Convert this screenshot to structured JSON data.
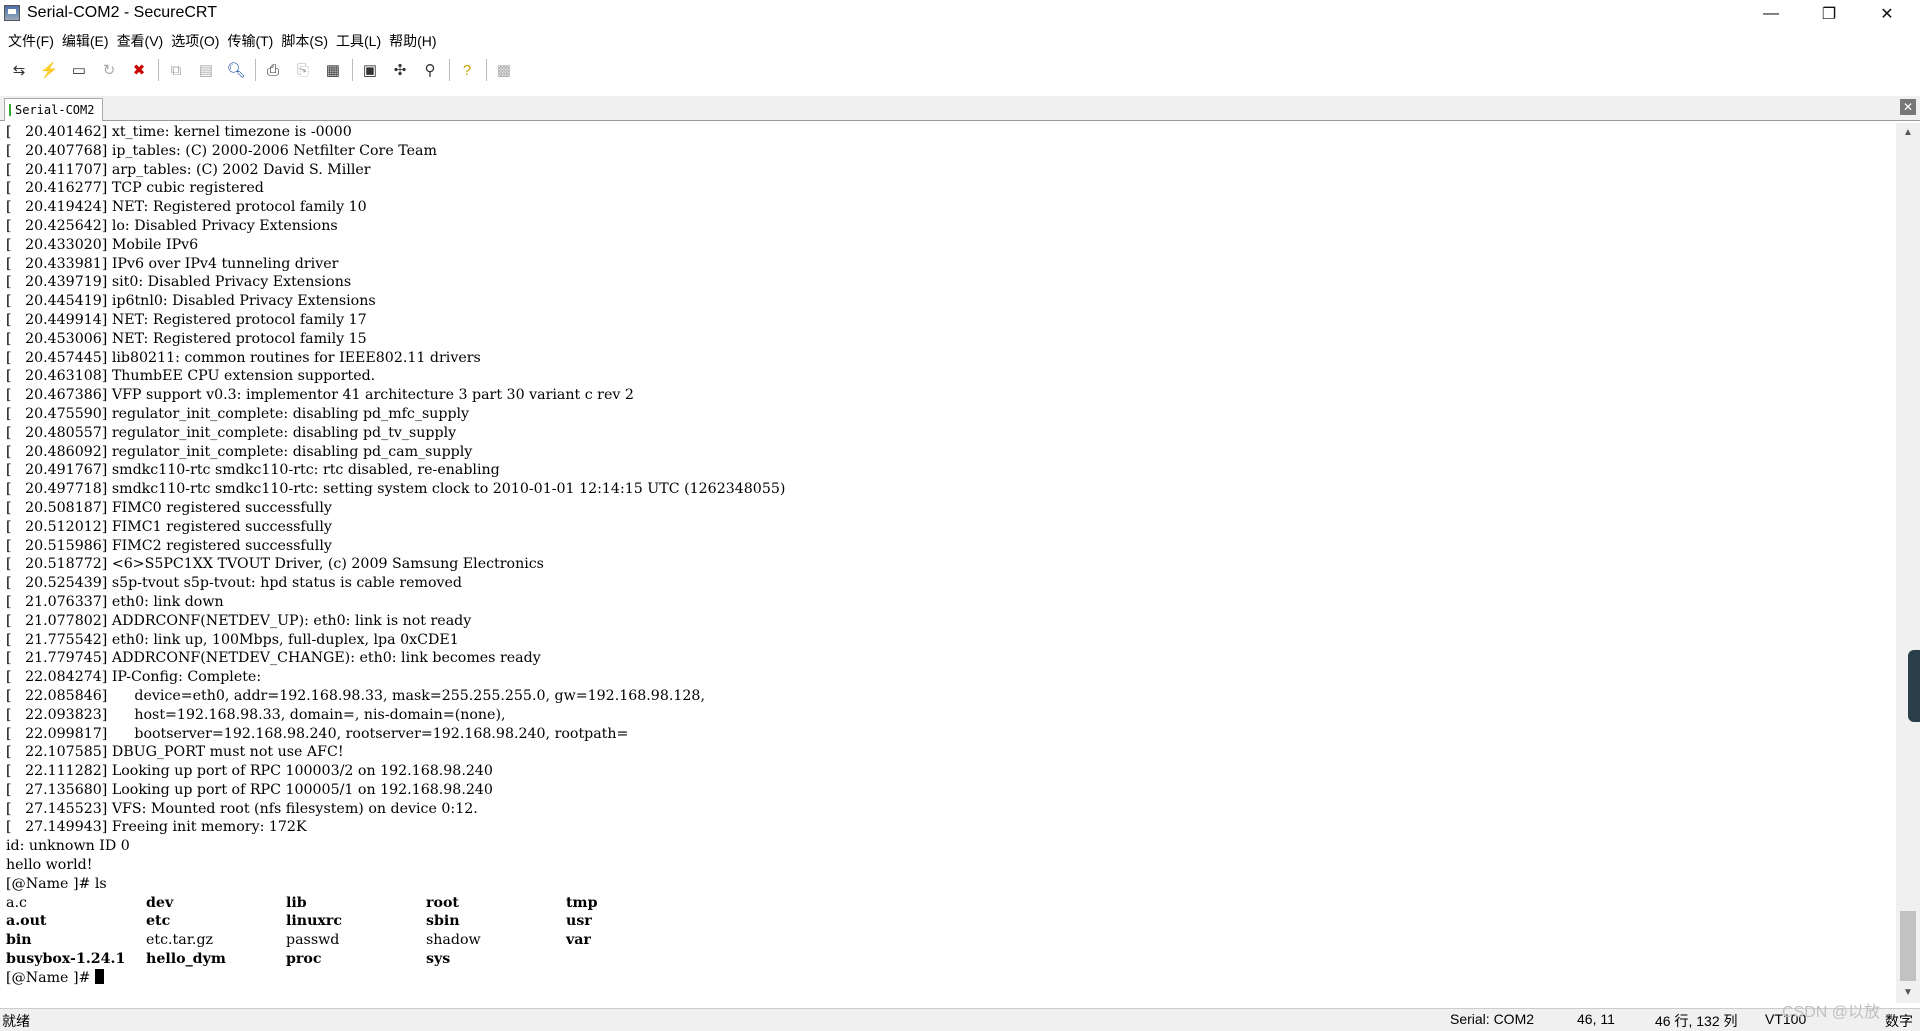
{
  "window": {
    "title": "Serial-COM2 - SecureCRT",
    "controls": {
      "minimize": "—",
      "maximize": "❐",
      "close": "✕"
    }
  },
  "menu": [
    "文件(F)",
    "编辑(E)",
    "查看(V)",
    "选项(O)",
    "传输(T)",
    "脚本(S)",
    "工具(L)",
    "帮助(H)"
  ],
  "toolbar_icons": [
    "connect-icon",
    "quick-connect-icon",
    "connect-tab-icon",
    "reconnect-icon",
    "disconnect-icon",
    "copy-icon",
    "paste-icon",
    "find-icon",
    "print-icon",
    "print-selection-icon",
    "printer-icon",
    "session-options-icon",
    "global-options-icon",
    "keymap-icon",
    "help-icon",
    "sftp-icon"
  ],
  "tab": {
    "label": "Serial-COM2",
    "close": "✕"
  },
  "terminal": {
    "lines": [
      "[   20.401462] xt_time: kernel timezone is -0000",
      "[   20.407768] ip_tables: (C) 2000-2006 Netfilter Core Team",
      "[   20.411707] arp_tables: (C) 2002 David S. Miller",
      "[   20.416277] TCP cubic registered",
      "[   20.419424] NET: Registered protocol family 10",
      "[   20.425642] lo: Disabled Privacy Extensions",
      "[   20.433020] Mobile IPv6",
      "[   20.433981] IPv6 over IPv4 tunneling driver",
      "[   20.439719] sit0: Disabled Privacy Extensions",
      "[   20.445419] ip6tnl0: Disabled Privacy Extensions",
      "[   20.449914] NET: Registered protocol family 17",
      "[   20.453006] NET: Registered protocol family 15",
      "[   20.457445] lib80211: common routines for IEEE802.11 drivers",
      "[   20.463108] ThumbEE CPU extension supported.",
      "[   20.467386] VFP support v0.3: implementor 41 architecture 3 part 30 variant c rev 2",
      "[   20.475590] regulator_init_complete: disabling pd_mfc_supply",
      "[   20.480557] regulator_init_complete: disabling pd_tv_supply",
      "[   20.486092] regulator_init_complete: disabling pd_cam_supply",
      "[   20.491767] smdkc110-rtc smdkc110-rtc: rtc disabled, re-enabling",
      "[   20.497718] smdkc110-rtc smdkc110-rtc: setting system clock to 2010-01-01 12:14:15 UTC (1262348055)",
      "[   20.508187] FIMC0 registered successfully",
      "[   20.512012] FIMC1 registered successfully",
      "[   20.515986] FIMC2 registered successfully",
      "[   20.518772] <6>S5PC1XX TVOUT Driver, (c) 2009 Samsung Electronics",
      "[   20.525439] s5p-tvout s5p-tvout: hpd status is cable removed",
      "[   21.076337] eth0: link down",
      "[   21.077802] ADDRCONF(NETDEV_UP): eth0: link is not ready",
      "[   21.775542] eth0: link up, 100Mbps, full-duplex, lpa 0xCDE1",
      "[   21.779745] ADDRCONF(NETDEV_CHANGE): eth0: link becomes ready",
      "[   22.084274] IP-Config: Complete:",
      "[   22.085846]      device=eth0, addr=192.168.98.33, mask=255.255.255.0, gw=192.168.98.128,",
      "[   22.093823]      host=192.168.98.33, domain=, nis-domain=(none),",
      "[   22.099817]      bootserver=192.168.98.240, rootserver=192.168.98.240, rootpath=",
      "[   22.107585] DBUG_PORT must not use AFC!",
      "[   22.111282] Looking up port of RPC 100003/2 on 192.168.98.240",
      "[   27.135680] Looking up port of RPC 100005/1 on 192.168.98.240",
      "[   27.145523] VFS: Mounted root (nfs filesystem) on device 0:12.",
      "[   27.149943] Freeing init memory: 172K",
      "id: unknown ID 0",
      "hello world!",
      "[@Name ]# ls"
    ],
    "ls_output": [
      {
        "name": "a.c",
        "bold": false
      },
      {
        "name": "dev",
        "bold": true
      },
      {
        "name": "lib",
        "bold": true
      },
      {
        "name": "root",
        "bold": true
      },
      {
        "name": "tmp",
        "bold": true
      },
      {
        "name": "a.out",
        "bold": true
      },
      {
        "name": "etc",
        "bold": true
      },
      {
        "name": "linuxrc",
        "bold": true
      },
      {
        "name": "sbin",
        "bold": true
      },
      {
        "name": "usr",
        "bold": true
      },
      {
        "name": "bin",
        "bold": true
      },
      {
        "name": "etc.tar.gz",
        "bold": false
      },
      {
        "name": "passwd",
        "bold": false
      },
      {
        "name": "shadow",
        "bold": false
      },
      {
        "name": "var",
        "bold": true
      },
      {
        "name": "busybox-1.24.1",
        "bold": true
      },
      {
        "name": "hello_dym",
        "bold": true
      },
      {
        "name": "proc",
        "bold": true
      },
      {
        "name": "sys",
        "bold": true
      },
      {
        "name": "",
        "bold": false
      }
    ],
    "prompt": "[@Name ]# "
  },
  "status": {
    "ready": "就绪",
    "connection": "Serial: COM2",
    "position": "46,  11",
    "rows_cols": "46 行, 132 列",
    "terminal_type": "VT100",
    "mode": "数字"
  },
  "watermark": "CSDN @以放"
}
